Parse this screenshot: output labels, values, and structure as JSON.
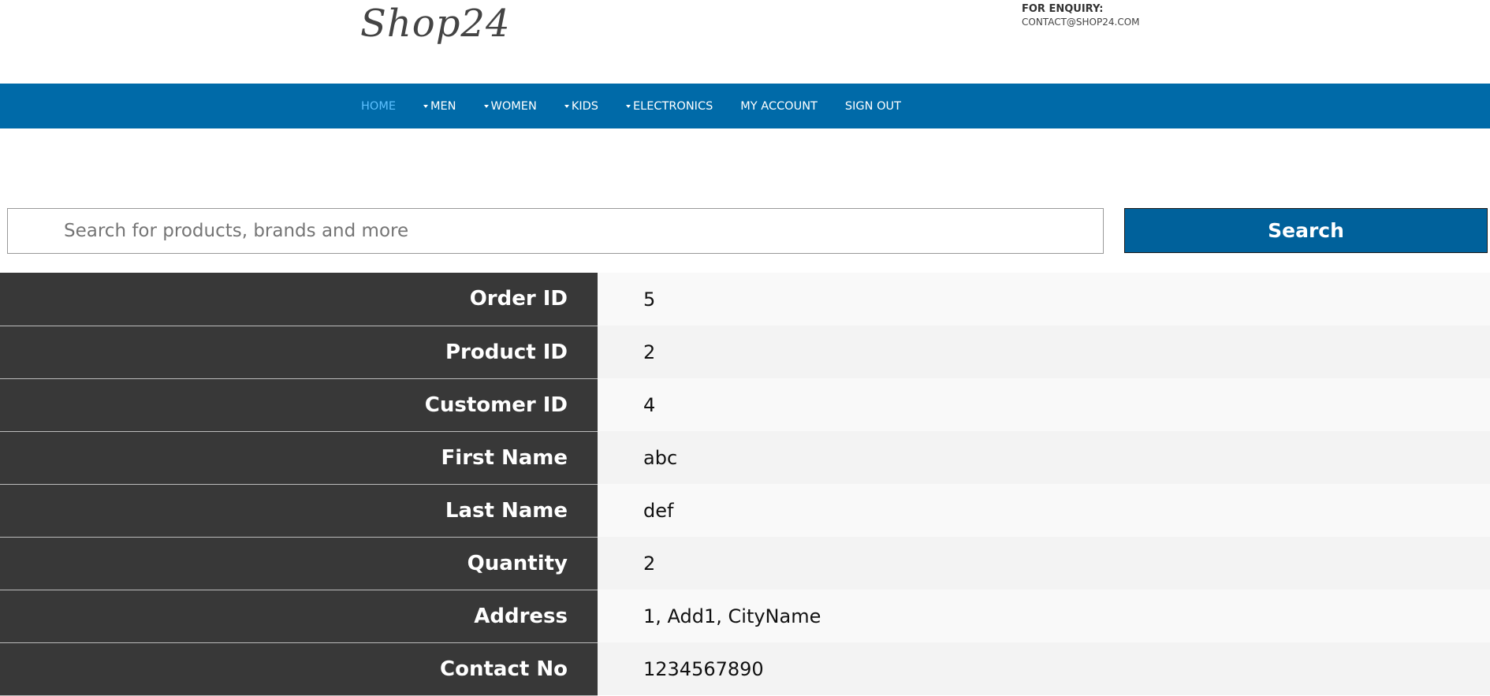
{
  "header": {
    "logo": "Shop24",
    "enquiry_label": "FOR ENQUIRY:",
    "enquiry_email": "CONTACT@SHOP24.COM"
  },
  "nav": {
    "home": "HOME",
    "men": "MEN",
    "women": "WOMEN",
    "kids": "KIDS",
    "electronics": "ELECTRONICS",
    "my_account": "MY ACCOUNT",
    "sign_out": "SIGN OUT"
  },
  "search": {
    "placeholder": "Search for products, brands and more",
    "button_label": "Search"
  },
  "order": {
    "rows": [
      {
        "label": "Order ID",
        "value": "5"
      },
      {
        "label": "Product ID",
        "value": "2"
      },
      {
        "label": "Customer ID",
        "value": "4"
      },
      {
        "label": "First Name",
        "value": "abc"
      },
      {
        "label": "Last Name",
        "value": "def"
      },
      {
        "label": "Quantity",
        "value": "2"
      },
      {
        "label": "Address",
        "value": "1, Add1, CityName"
      },
      {
        "label": "Contact No",
        "value": "1234567890"
      }
    ]
  },
  "colors": {
    "nav_bg": "#006aa8",
    "nav_active": "#5cc0ff",
    "search_button": "#00619b",
    "label_bg": "#383838"
  },
  "icons": {
    "dropdown": "caret-down-icon"
  }
}
